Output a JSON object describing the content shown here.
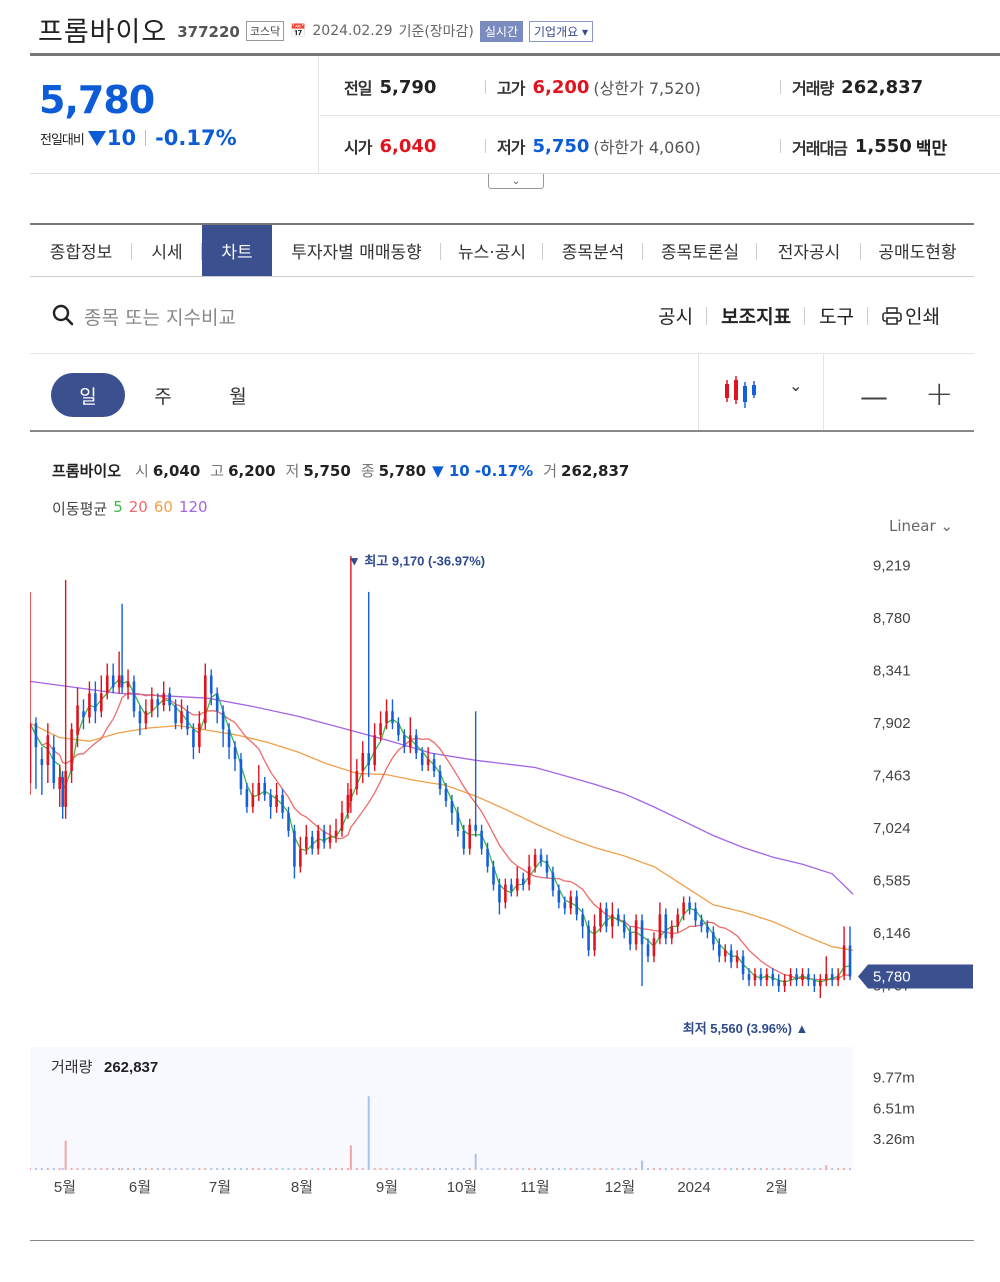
{
  "header": {
    "company_name": "프롬바이오",
    "code": "377220",
    "market": "코스닥",
    "date": "2024.02.29",
    "basis": "기준(장마감)",
    "realtime": "실시간",
    "company_overview": "기업개요"
  },
  "price": {
    "current": "5,780",
    "change_label": "전일대비",
    "change_amount": "10",
    "change_pct": "-0.17%"
  },
  "stats": {
    "prev_label": "전일",
    "prev_value": "5,790",
    "high_label": "고가",
    "high_value": "6,200",
    "upper_limit": "(상한가 7,520)",
    "volume_label": "거래량",
    "volume_value": "262,837",
    "open_label": "시가",
    "open_value": "6,040",
    "low_label": "저가",
    "low_value": "5,750",
    "lower_limit": "(하한가 4,060)",
    "amount_label": "거래대금",
    "amount_value": "1,550",
    "amount_unit": "백만"
  },
  "tabs": [
    "종합정보",
    "시세",
    "차트",
    "투자자별 매매동향",
    "뉴스·공시",
    "종목분석",
    "종목토론실",
    "전자공시",
    "공매도현황"
  ],
  "active_tab": 2,
  "search": {
    "placeholder": "종목 또는 지수비교"
  },
  "tools": [
    "공시",
    "보조지표",
    "도구",
    "인쇄"
  ],
  "periods": [
    "일",
    "주",
    "월"
  ],
  "legend": {
    "name": "프롬바이오",
    "open_k": "시",
    "open_v": "6,040",
    "high_k": "고",
    "high_v": "6,200",
    "low_k": "저",
    "low_v": "5,750",
    "close_k": "종",
    "close_v": "5,780",
    "change": "▼ 10 -0.17%",
    "vol_k": "거",
    "vol_v": "262,837",
    "ma_label": "이동평균",
    "ma": [
      "5",
      "20",
      "60",
      "120"
    ]
  },
  "scale_mode": "Linear",
  "colors": {
    "up": "#e0141e",
    "down": "#1560d8",
    "ma5": "#3db84a",
    "ma20": "#ef6a6a",
    "ma60": "#f0a04b",
    "ma120": "#a563e8",
    "accent": "#3c4f8f"
  },
  "chart_data": {
    "type": "candlestick",
    "title": "프롬바이오",
    "x_labels": [
      "5월",
      "6월",
      "7월",
      "8월",
      "9월",
      "10월",
      "11월",
      "12월",
      "2024",
      "2월"
    ],
    "y_ticks": [
      "9,219",
      "8,780",
      "8,341",
      "7,902",
      "7,463",
      "7,024",
      "6,585",
      "6,146",
      "5,707"
    ],
    "ylim": [
      5500,
      9350
    ],
    "current_label": "5,780",
    "current": 5780,
    "max_label": "▼ 최고 9,170 (-36.97%)",
    "max": 9170,
    "min_label": "최저 5,560 (3.96%) ▲",
    "min": 5560,
    "volume_label": "거래량",
    "volume_value": "262,837",
    "volume_ticks": [
      "9.77m",
      "6.51m",
      "3.26m"
    ],
    "volume_ylim": [
      0,
      13000000
    ],
    "ma120": [
      [
        0,
        8250
      ],
      [
        15,
        8200
      ],
      [
        30,
        8150
      ],
      [
        45,
        8130
      ],
      [
        60,
        8110
      ],
      [
        75,
        8040
      ],
      [
        90,
        7960
      ],
      [
        105,
        7860
      ],
      [
        120,
        7760
      ],
      [
        135,
        7650
      ],
      [
        150,
        7590
      ],
      [
        160,
        7560
      ],
      [
        170,
        7530
      ],
      [
        180,
        7460
      ],
      [
        190,
        7390
      ],
      [
        200,
        7310
      ],
      [
        210,
        7200
      ],
      [
        220,
        7080
      ],
      [
        230,
        6960
      ],
      [
        240,
        6860
      ],
      [
        250,
        6780
      ],
      [
        260,
        6720
      ],
      [
        270,
        6640
      ],
      [
        277,
        6470
      ]
    ],
    "ma60": [
      [
        0,
        7900
      ],
      [
        10,
        7780
      ],
      [
        20,
        7750
      ],
      [
        30,
        7820
      ],
      [
        40,
        7860
      ],
      [
        50,
        7880
      ],
      [
        60,
        7840
      ],
      [
        70,
        7800
      ],
      [
        80,
        7740
      ],
      [
        90,
        7660
      ],
      [
        100,
        7560
      ],
      [
        110,
        7480
      ],
      [
        120,
        7470
      ],
      [
        130,
        7420
      ],
      [
        140,
        7380
      ],
      [
        150,
        7290
      ],
      [
        160,
        7180
      ],
      [
        170,
        7060
      ],
      [
        180,
        6950
      ],
      [
        190,
        6860
      ],
      [
        200,
        6790
      ],
      [
        210,
        6700
      ],
      [
        220,
        6540
      ],
      [
        230,
        6380
      ],
      [
        240,
        6320
      ],
      [
        250,
        6240
      ],
      [
        260,
        6130
      ],
      [
        270,
        6030
      ],
      [
        277,
        6000
      ]
    ],
    "candles": [
      [
        0,
        7400,
        7900,
        9000,
        7300
      ],
      [
        2,
        7900,
        7700,
        7950,
        7350
      ],
      [
        4,
        7600,
        7550,
        7700,
        7300
      ],
      [
        6,
        7550,
        7800,
        7900,
        7400
      ],
      [
        8,
        7700,
        7400,
        7800,
        7350
      ],
      [
        10,
        7350,
        7450,
        7550,
        7200
      ],
      [
        11,
        7450,
        7200,
        7500,
        7100
      ],
      [
        12,
        7200,
        7500,
        9100,
        7100
      ],
      [
        14,
        7500,
        7850,
        7900,
        7400
      ],
      [
        16,
        7800,
        8050,
        8200,
        7700
      ],
      [
        18,
        8000,
        7950,
        8100,
        7850
      ],
      [
        20,
        7950,
        8150,
        8250,
        7900
      ],
      [
        22,
        8150,
        8000,
        8250,
        7900
      ],
      [
        24,
        8000,
        8150,
        8300,
        7950
      ],
      [
        26,
        8150,
        8300,
        8400,
        8100
      ],
      [
        28,
        8300,
        8200,
        8400,
        8150
      ],
      [
        30,
        8200,
        8300,
        8500,
        8150
      ],
      [
        31,
        8300,
        8200,
        8900,
        8150
      ],
      [
        33,
        8200,
        8250,
        8350,
        8100
      ],
      [
        35,
        8250,
        8000,
        8300,
        7950
      ],
      [
        37,
        8000,
        7900,
        8050,
        7800
      ],
      [
        39,
        7900,
        8000,
        8100,
        7850
      ],
      [
        41,
        8000,
        8100,
        8200,
        7950
      ],
      [
        43,
        8100,
        8050,
        8150,
        7950
      ],
      [
        45,
        8050,
        8150,
        8250,
        8000
      ],
      [
        47,
        8150,
        8050,
        8200,
        8000
      ],
      [
        49,
        8050,
        7900,
        8100,
        7850
      ],
      [
        51,
        7900,
        8000,
        8100,
        7850
      ],
      [
        53,
        8000,
        7850,
        8050,
        7800
      ],
      [
        55,
        7850,
        7700,
        7900,
        7600
      ],
      [
        57,
        7700,
        7900,
        8000,
        7650
      ],
      [
        59,
        7900,
        8300,
        8400,
        7850
      ],
      [
        61,
        8300,
        8150,
        8350,
        8050
      ],
      [
        63,
        8150,
        8000,
        8200,
        7900
      ],
      [
        65,
        8000,
        7850,
        8050,
        7700
      ],
      [
        67,
        7850,
        7700,
        7900,
        7600
      ],
      [
        69,
        7700,
        7600,
        7750,
        7500
      ],
      [
        71,
        7600,
        7350,
        7650,
        7300
      ],
      [
        73,
        7350,
        7200,
        7400,
        7150
      ],
      [
        75,
        7200,
        7300,
        7400,
        7150
      ],
      [
        77,
        7300,
        7400,
        7550,
        7250
      ],
      [
        79,
        7400,
        7300,
        7450,
        7250
      ],
      [
        81,
        7300,
        7200,
        7350,
        7100
      ],
      [
        83,
        7200,
        7300,
        7400,
        7150
      ],
      [
        85,
        7300,
        7150,
        7350,
        7100
      ],
      [
        87,
        7150,
        7000,
        7200,
        6950
      ],
      [
        89,
        7000,
        6700,
        7050,
        6600
      ],
      [
        91,
        6700,
        6850,
        6950,
        6650
      ],
      [
        93,
        6850,
        6950,
        7050,
        6800
      ],
      [
        95,
        6950,
        6850,
        7000,
        6800
      ],
      [
        97,
        6850,
        7000,
        7050,
        6800
      ],
      [
        99,
        7000,
        6900,
        7050,
        6850
      ],
      [
        101,
        6900,
        6950,
        7050,
        6850
      ],
      [
        103,
        6950,
        7000,
        7100,
        6900
      ],
      [
        105,
        7000,
        7150,
        7250,
        6950
      ],
      [
        107,
        7150,
        7300,
        7400,
        7100
      ],
      [
        108,
        7250,
        7350,
        9300,
        7150
      ],
      [
        110,
        7350,
        7500,
        7600,
        7300
      ],
      [
        112,
        7500,
        7650,
        7750,
        7400
      ],
      [
        114,
        7650,
        7550,
        9000,
        7450
      ],
      [
        116,
        7550,
        7800,
        7900,
        7500
      ],
      [
        118,
        7800,
        7900,
        8000,
        7750
      ],
      [
        120,
        7900,
        8000,
        8100,
        7850
      ],
      [
        122,
        8000,
        7900,
        8100,
        7850
      ],
      [
        124,
        7900,
        7800,
        7950,
        7750
      ],
      [
        126,
        7800,
        7700,
        7850,
        7650
      ],
      [
        128,
        7700,
        7800,
        7950,
        7650
      ],
      [
        130,
        7800,
        7650,
        7850,
        7600
      ],
      [
        132,
        7650,
        7550,
        7700,
        7500
      ],
      [
        134,
        7550,
        7600,
        7700,
        7500
      ],
      [
        136,
        7600,
        7500,
        7650,
        7450
      ],
      [
        138,
        7500,
        7350,
        7550,
        7300
      ],
      [
        140,
        7350,
        7250,
        7400,
        7200
      ],
      [
        142,
        7250,
        7150,
        7300,
        7050
      ],
      [
        144,
        7150,
        7000,
        7200,
        6950
      ],
      [
        146,
        7000,
        6850,
        7050,
        6800
      ],
      [
        148,
        6850,
        7050,
        7100,
        6800
      ],
      [
        150,
        7050,
        7000,
        8000,
        6950
      ],
      [
        152,
        7000,
        6850,
        7050,
        6800
      ],
      [
        154,
        6850,
        6700,
        6900,
        6650
      ],
      [
        156,
        6700,
        6550,
        6750,
        6500
      ],
      [
        158,
        6550,
        6400,
        6600,
        6300
      ],
      [
        160,
        6400,
        6550,
        6600,
        6350
      ],
      [
        162,
        6550,
        6500,
        6600,
        6450
      ],
      [
        164,
        6500,
        6600,
        6700,
        6450
      ],
      [
        166,
        6600,
        6550,
        6650,
        6500
      ],
      [
        168,
        6550,
        6700,
        6800,
        6500
      ],
      [
        170,
        6700,
        6800,
        6850,
        6650
      ],
      [
        172,
        6800,
        6750,
        6850,
        6700
      ],
      [
        174,
        6750,
        6650,
        6800,
        6600
      ],
      [
        176,
        6650,
        6500,
        6700,
        6450
      ],
      [
        178,
        6500,
        6400,
        6550,
        6350
      ],
      [
        180,
        6400,
        6350,
        6450,
        6300
      ],
      [
        182,
        6350,
        6450,
        6500,
        6300
      ],
      [
        184,
        6450,
        6300,
        6500,
        6250
      ],
      [
        186,
        6300,
        6200,
        6350,
        6100
      ],
      [
        188,
        6200,
        6000,
        6250,
        5950
      ],
      [
        190,
        6000,
        6200,
        6300,
        5950
      ],
      [
        192,
        6200,
        6350,
        6400,
        6150
      ],
      [
        194,
        6350,
        6200,
        6400,
        6150
      ],
      [
        196,
        6200,
        6300,
        6400,
        6100
      ],
      [
        198,
        6300,
        6250,
        6350,
        6200
      ],
      [
        200,
        6250,
        6150,
        6300,
        6100
      ],
      [
        202,
        6150,
        6050,
        6200,
        6000
      ],
      [
        204,
        6050,
        6250,
        6300,
        6000
      ],
      [
        206,
        6250,
        6050,
        6300,
        5700
      ],
      [
        208,
        6050,
        5950,
        6100,
        5900
      ],
      [
        210,
        5950,
        6100,
        6150,
        5900
      ],
      [
        212,
        6100,
        6300,
        6400,
        6050
      ],
      [
        214,
        6300,
        6100,
        6350,
        6050
      ],
      [
        216,
        6100,
        6200,
        6250,
        6050
      ],
      [
        218,
        6200,
        6300,
        6350,
        6150
      ],
      [
        220,
        6300,
        6400,
        6450,
        6250
      ],
      [
        222,
        6400,
        6350,
        6450,
        6300
      ],
      [
        224,
        6350,
        6250,
        6400,
        6200
      ],
      [
        226,
        6250,
        6200,
        6300,
        6150
      ],
      [
        228,
        6200,
        6150,
        6250,
        6100
      ],
      [
        230,
        6150,
        6050,
        6200,
        6000
      ],
      [
        232,
        6050,
        5950,
        6100,
        5900
      ],
      [
        234,
        5950,
        6000,
        6050,
        5900
      ],
      [
        236,
        6000,
        5900,
        6050,
        5850
      ],
      [
        238,
        5900,
        5950,
        6000,
        5850
      ],
      [
        240,
        5950,
        5800,
        6000,
        5750
      ],
      [
        242,
        5800,
        5750,
        5850,
        5700
      ],
      [
        244,
        5750,
        5800,
        5850,
        5700
      ],
      [
        246,
        5800,
        5750,
        5850,
        5700
      ],
      [
        248,
        5750,
        5800,
        5850,
        5700
      ],
      [
        250,
        5800,
        5750,
        5850,
        5700
      ],
      [
        252,
        5750,
        5700,
        5800,
        5650
      ],
      [
        254,
        5700,
        5750,
        5800,
        5650
      ],
      [
        256,
        5750,
        5800,
        5850,
        5700
      ],
      [
        258,
        5800,
        5750,
        5850,
        5700
      ],
      [
        260,
        5750,
        5800,
        5850,
        5700
      ],
      [
        262,
        5800,
        5750,
        5850,
        5700
      ],
      [
        264,
        5750,
        5700,
        5800,
        5650
      ],
      [
        266,
        5700,
        5750,
        5800,
        5600
      ],
      [
        268,
        5750,
        5800,
        5950,
        5700
      ],
      [
        270,
        5800,
        5750,
        5850,
        5700
      ],
      [
        272,
        5750,
        5790,
        5850,
        5700
      ],
      [
        274,
        5790,
        6040,
        6200,
        5750
      ],
      [
        276,
        6040,
        5780,
        6200,
        5750
      ]
    ]
  }
}
